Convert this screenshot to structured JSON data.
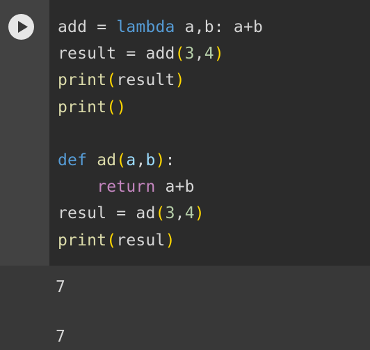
{
  "colors": {
    "gutter_bg": "#424242",
    "editor_bg": "#2b2b2b",
    "output_bg": "#383838",
    "run_button_bg": "#e6e6e6",
    "keyword": "#569cd6",
    "control_keyword": "#c586c0",
    "function": "#dcdcaa",
    "variable": "#9cdcfe",
    "number": "#b5cea8",
    "bracket": "#ffd700",
    "text": "#d6d6d6"
  },
  "run_button": {
    "icon": "play-icon"
  },
  "code": {
    "lines": [
      [
        {
          "t": "add",
          "c": "text"
        },
        {
          "t": " = ",
          "c": "text"
        },
        {
          "t": "lambda",
          "c": "kw"
        },
        {
          "t": " a,b: a+b",
          "c": "text"
        }
      ],
      [
        {
          "t": "result",
          "c": "text"
        },
        {
          "t": " = ",
          "c": "text"
        },
        {
          "t": "add",
          "c": "text"
        },
        {
          "t": "(",
          "c": "paren"
        },
        {
          "t": "3",
          "c": "num"
        },
        {
          "t": ",",
          "c": "text"
        },
        {
          "t": "4",
          "c": "num"
        },
        {
          "t": ")",
          "c": "paren"
        }
      ],
      [
        {
          "t": "print",
          "c": "fn"
        },
        {
          "t": "(",
          "c": "paren"
        },
        {
          "t": "result",
          "c": "text"
        },
        {
          "t": ")",
          "c": "paren"
        }
      ],
      [
        {
          "t": "print",
          "c": "fn"
        },
        {
          "t": "(",
          "c": "paren"
        },
        {
          "t": ")",
          "c": "paren"
        }
      ],
      [],
      [
        {
          "t": "def",
          "c": "def"
        },
        {
          "t": " ad",
          "c": "fn"
        },
        {
          "t": "(",
          "c": "paren"
        },
        {
          "t": "a",
          "c": "var"
        },
        {
          "t": ",",
          "c": "text"
        },
        {
          "t": "b",
          "c": "var"
        },
        {
          "t": ")",
          "c": "paren"
        },
        {
          "t": ":",
          "c": "text"
        }
      ],
      [
        {
          "t": "    ",
          "c": "text"
        },
        {
          "t": "return",
          "c": "ctl"
        },
        {
          "t": " a+b",
          "c": "text"
        }
      ],
      [
        {
          "t": "resul",
          "c": "text"
        },
        {
          "t": " = ",
          "c": "text"
        },
        {
          "t": "ad",
          "c": "text"
        },
        {
          "t": "(",
          "c": "paren"
        },
        {
          "t": "3",
          "c": "num"
        },
        {
          "t": ",",
          "c": "text"
        },
        {
          "t": "4",
          "c": "num"
        },
        {
          "t": ")",
          "c": "paren"
        }
      ],
      [
        {
          "t": "print",
          "c": "fn"
        },
        {
          "t": "(",
          "c": "paren"
        },
        {
          "t": "resul",
          "c": "text"
        },
        {
          "t": ")",
          "c": "paren"
        }
      ]
    ]
  },
  "output": {
    "lines": [
      "7",
      "",
      "7"
    ]
  }
}
